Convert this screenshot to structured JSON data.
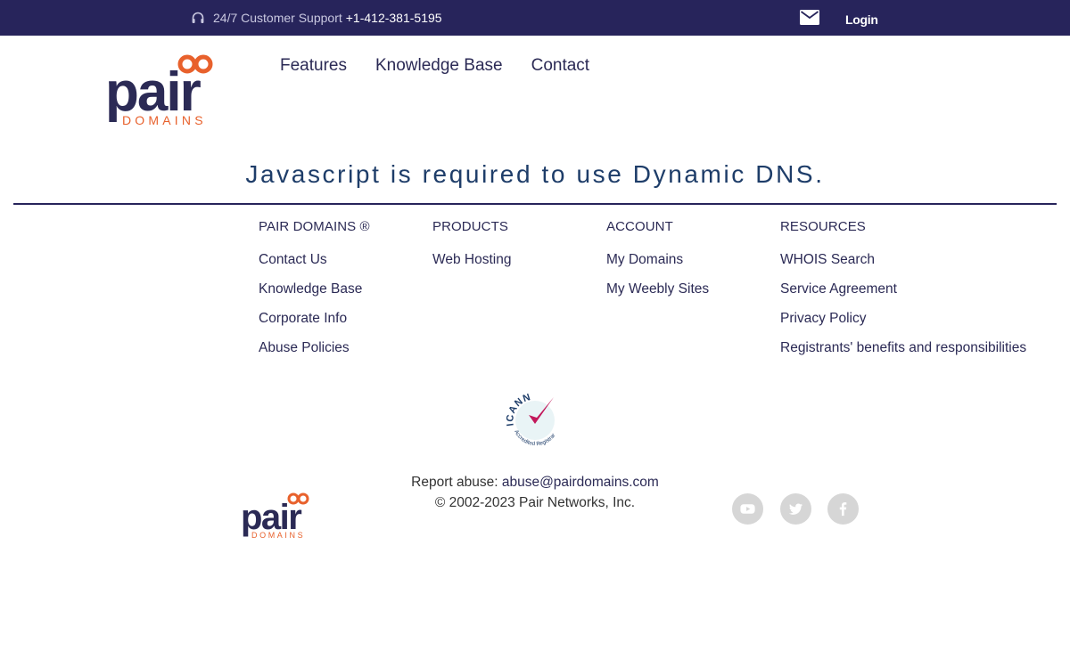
{
  "topbar": {
    "support_label": "24/7 Customer Support",
    "support_phone": "+1-412-381-5195",
    "login_label": "Login"
  },
  "logo": {
    "name": "pair",
    "sub": "DOMAINS"
  },
  "nav": [
    {
      "label": "Features"
    },
    {
      "label": "Knowledge Base"
    },
    {
      "label": "Contact"
    }
  ],
  "main": {
    "message": "Javascript is required to use Dynamic DNS."
  },
  "footer": {
    "columns": [
      {
        "heading": "PAIR DOMAINS ®",
        "links": [
          "Contact Us",
          "Knowledge Base",
          "Corporate Info",
          "Abuse Policies"
        ]
      },
      {
        "heading": "PRODUCTS",
        "links": [
          "Web Hosting"
        ]
      },
      {
        "heading": "ACCOUNT",
        "links": [
          "My Domains",
          "My Weebly Sites"
        ]
      },
      {
        "heading": "RESOURCES",
        "links": [
          "WHOIS Search",
          "Service Agreement",
          "Privacy Policy",
          "Registrants' benefits and responsibilities"
        ]
      }
    ],
    "icann": {
      "name": "ICANN",
      "sub": "Accredited Registrar"
    },
    "report_label": "Report abuse:",
    "report_email": "abuse@pairdomains.com",
    "copyright": "© 2002-2023 Pair Networks, Inc.",
    "social_icons": [
      "youtube-icon",
      "twitter-icon",
      "facebook-icon"
    ]
  },
  "colors": {
    "topbar_bg": "#27245b",
    "brand_navy": "#2b2a55",
    "brand_orange": "#e8612c",
    "message_blue": "#1e3d69",
    "social_gray": "#d6d6d6"
  }
}
